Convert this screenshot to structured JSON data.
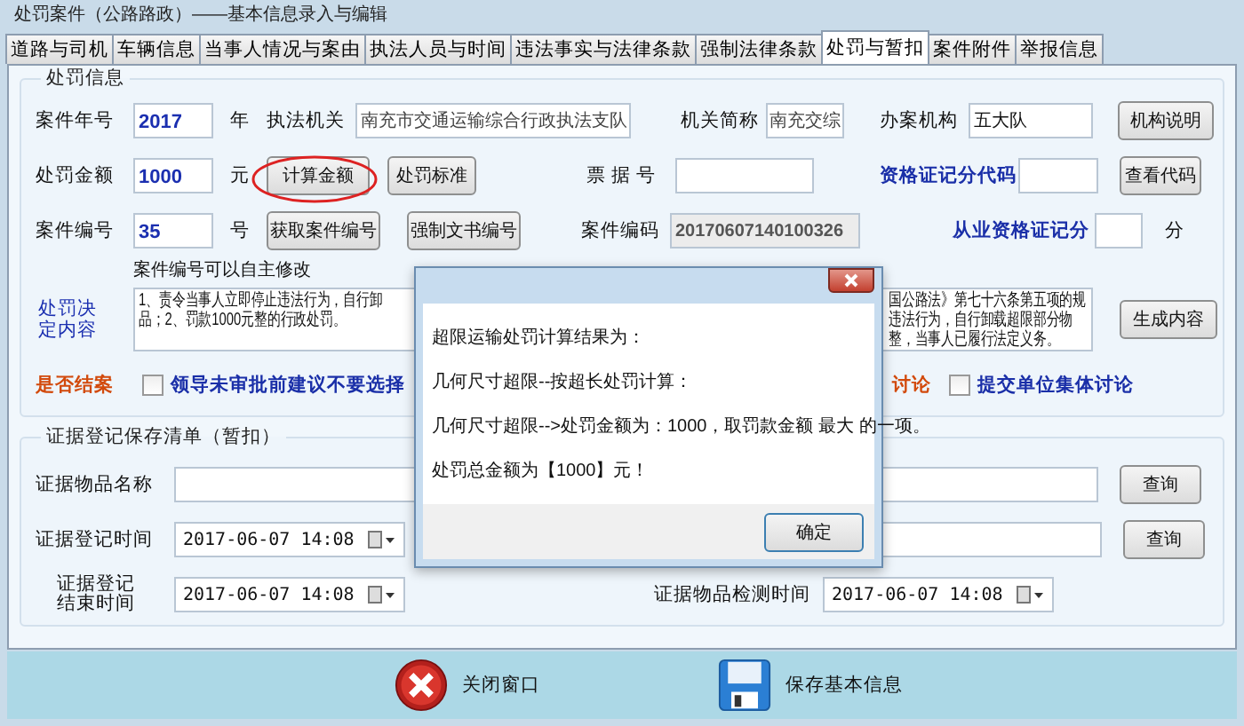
{
  "window": {
    "title": "处罚案件（公路路政）——基本信息录入与编辑"
  },
  "tabs": [
    {
      "label": "道路与司机",
      "selected": false
    },
    {
      "label": "车辆信息",
      "selected": false
    },
    {
      "label": "当事人情况与案由",
      "selected": false
    },
    {
      "label": "执法人员与时间",
      "selected": false
    },
    {
      "label": "违法事实与法律条款",
      "selected": false
    },
    {
      "label": "强制法律条款",
      "selected": false
    },
    {
      "label": "处罚与暂扣",
      "selected": true
    },
    {
      "label": "案件附件",
      "selected": false
    },
    {
      "label": "举报信息",
      "selected": false
    }
  ],
  "penalty_info": {
    "title": "处罚信息",
    "case_year": {
      "label": "案件年号",
      "value": "2017",
      "unit": "年"
    },
    "agency": {
      "label": "执法机关",
      "value": "南充市交通运输综合行政执法支队"
    },
    "agency_short": {
      "label": "机关简称",
      "value": "南充交综"
    },
    "office": {
      "label": "办案机构",
      "value": "五大队"
    },
    "office_button": "机构说明",
    "amount": {
      "label": "处罚金额",
      "value": "1000",
      "unit": "元"
    },
    "calc_button": "计算金额",
    "standard_button": "处罚标准",
    "receipt_no": {
      "label": "票 据 号"
    },
    "cert_code": {
      "label": "资格证记分代码"
    },
    "view_code_button": "查看代码",
    "case_no": {
      "label": "案件编号",
      "value": "35",
      "unit": "号"
    },
    "get_no_button": "获取案件编号",
    "doc_no_button": "强制文书编号",
    "case_code": {
      "label": "案件编码",
      "value": "20170607140100326"
    },
    "cert_points": {
      "label": "从业资格证记分",
      "unit": "分"
    },
    "case_no_hint": "案件编号可以自主修改",
    "decision": {
      "label": "处罚决定内容",
      "left_lines": [
        "1、责令当事人立即停止违法行为，自行卸",
        "品；2、罚款1000元整的行政处罚。"
      ],
      "right_lines": [
        "国公路法》第七十六条第五项的规",
        "违法行为，自行卸载超限部分物",
        "整，当事人已履行法定义务。"
      ]
    },
    "generate_button": "生成内容",
    "closed_label": "是否结案",
    "partial_label": "讨论",
    "checkboxes": [
      {
        "label": "领导未审批前建议不要选择",
        "checked": false
      },
      {
        "label": "提交单位集体讨论",
        "checked": false
      }
    ]
  },
  "evidence": {
    "title": "证据登记保存清单（暂扣）",
    "item_name": {
      "label": "证据物品名称"
    },
    "query_buttons": [
      "查询",
      "查询"
    ],
    "reg_time": {
      "label": "证据登记时间",
      "value": "2017-06-07 14:08"
    },
    "end_time": {
      "label": "证据登记结束时间",
      "value": "2017-06-07 14:08"
    },
    "check_time": {
      "label": "证据物品检测时间",
      "value": "2017-06-07 14:08"
    }
  },
  "footer_buttons": [
    {
      "label": "关闭窗口",
      "kind": "close"
    },
    {
      "label": "保存基本信息",
      "kind": "save"
    }
  ],
  "dialog": {
    "lines": [
      "超限运输处罚计算结果为：",
      "几何尺寸超限--按超长处罚计算：",
      "几何尺寸超限-->处罚金额为：1000，取罚款金额 最大 的一项。",
      "处罚总金额为【1000】元！"
    ],
    "ok_button": "确定"
  }
}
